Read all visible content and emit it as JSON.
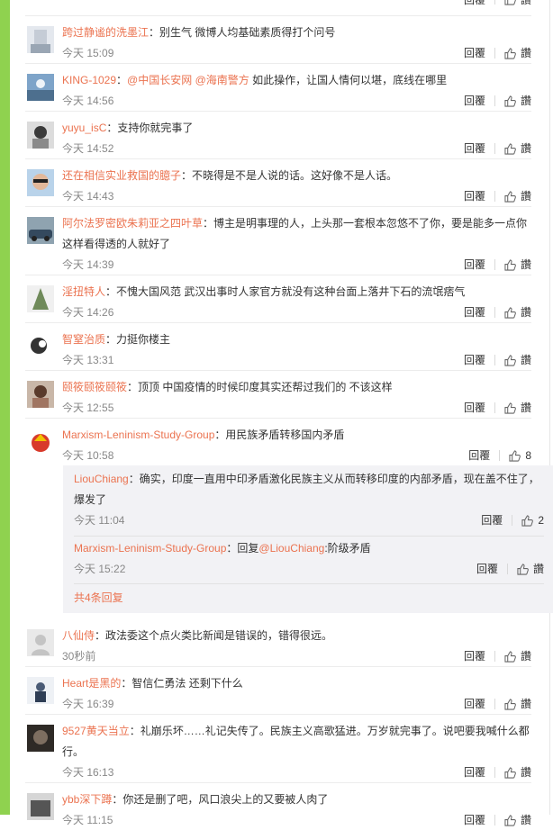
{
  "comments": [
    {
      "user": "跨过静谧的洗墨江",
      "text": "：别生气 微博人均基础素质得打个问号",
      "time": "今天 15:09",
      "reply": "回覆",
      "like": "讚"
    },
    {
      "user": "KING-1029",
      "text_prefix": "：",
      "mention1": "@中国长安网",
      "mention2": "@海南警方",
      "text": " 如此操作，让国人情何以堪，底线在哪里",
      "time": "今天 14:56",
      "reply": "回覆",
      "like": "讚"
    },
    {
      "user": "yuyu_isC",
      "text": "：支持你就完事了",
      "time": "今天 14:52",
      "reply": "回覆",
      "like": "讚"
    },
    {
      "user": "还在相信实业救国的臆子",
      "text": "：不晓得是不是人说的话。这好像不是人话。",
      "time": "今天 14:43",
      "reply": "回覆",
      "like": "讚"
    },
    {
      "user": "阿尔法罗密欧朱莉亚之四叶草",
      "text": "：博主是明事理的人，上头那一套根本忽悠不了你，要是能多一点你这样看得透的人就好了",
      "time": "今天 14:39",
      "reply": "回覆",
      "like": "讚"
    },
    {
      "user": "淫扭特人",
      "text": "：不愧大国风范 武汉出事时人家官方就没有这种台面上落井下石的流氓痞气",
      "time": "今天 14:26",
      "reply": "回覆",
      "like": "讚"
    },
    {
      "user": "智窒治质",
      "text": "：力挺你楼主",
      "time": "今天 13:31",
      "reply": "回覆",
      "like": "讚"
    },
    {
      "user": "颐筱颐筱颐筱",
      "text": "：顶顶 中国疫情的时候印度其实还帮过我们的 不该这样",
      "time": "今天 12:55",
      "reply": "回覆",
      "like": "讚"
    },
    {
      "user": "Marxism-Leninism-Study-Group",
      "text": "：用民族矛盾转移国内矛盾",
      "time": "今天 10:58",
      "reply": "回覆",
      "like": "8"
    },
    {
      "user": "八仙侍",
      "text": "：政法委这个点火类比新闻是错误的，错得很远。",
      "time": "30秒前",
      "reply": "回覆",
      "like": "讚"
    },
    {
      "user": "Heart是黑的",
      "text": "：智信仁勇法 还剩下什么",
      "time": "今天 16:39",
      "reply": "回覆",
      "like": "讚"
    },
    {
      "user": "9527黄天当立",
      "text": "：礼崩乐坏……礼记失传了。民族主义高歌猛进。万岁就完事了。说吧要我喊什么都行。",
      "time": "今天 16:13",
      "reply": "回覆",
      "like": "讚"
    },
    {
      "user": "ybb深下蹲",
      "text": "：你还是删了吧，风口浪尖上的又要被人肉了",
      "time": "今天 11:15",
      "reply": "回覆",
      "like": "讚"
    }
  ],
  "top_partial": {
    "reply": "回覆",
    "like": "讚"
  },
  "subreplies": [
    {
      "user": "LiouChiang",
      "text": "：确实，印度一直用中印矛盾激化民族主义从而转移印度的内部矛盾，现在盖不住了，爆发了",
      "time": "今天 11:04",
      "reply": "回覆",
      "like": "2"
    },
    {
      "user": "Marxism-Leninism-Study-Group",
      "text_prefix": "：回复",
      "mention": "@LiouChiang",
      "text": ":阶级矛盾",
      "time": "今天 15:22",
      "reply": "回覆",
      "like": "讚"
    }
  ],
  "more_replies": "共4条回复",
  "colors": {
    "accent": "#eb7350",
    "sidebar": "#8fd24f"
  }
}
